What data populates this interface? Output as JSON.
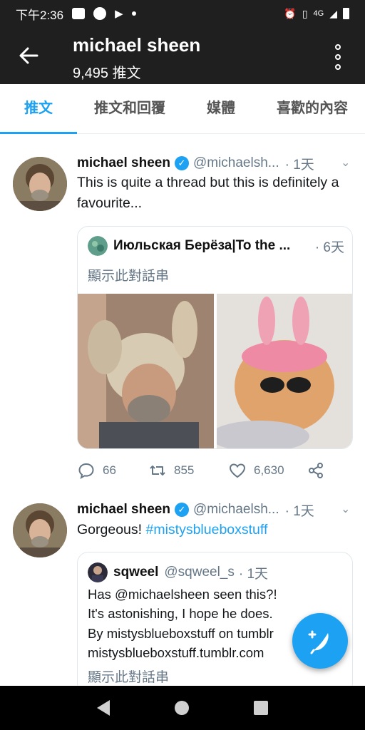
{
  "status_bar": {
    "time": "下午2:36",
    "network": "4G"
  },
  "header": {
    "title": "michael sheen",
    "subtitle": "9,495 推文",
    "back_icon": "arrow-left-icon",
    "menu_icon": "more-vertical-icon"
  },
  "tabs": [
    {
      "label": "推文",
      "active": true
    },
    {
      "label": "推文和回覆",
      "active": false
    },
    {
      "label": "媒體",
      "active": false
    },
    {
      "label": "喜歡的內容",
      "active": false
    }
  ],
  "tweets": [
    {
      "name": "michael sheen",
      "handle": "@michaelsh...",
      "time": "· 1天",
      "text": "This is quite a thread but this is definitely a favourite...",
      "quote": {
        "name": "Июльская Берёза|To the ...",
        "time": "· 6天",
        "link": "顯示此對話串"
      },
      "stats": {
        "replies": "66",
        "retweets": "855",
        "likes": "6,630"
      }
    },
    {
      "name": "michael sheen",
      "handle": "@michaelsh...",
      "time": "· 1天",
      "text_plain": "Gorgeous! ",
      "text_hashtag": "#mistysblueboxstuff",
      "quote": {
        "name": "sqweel",
        "handle": "@sqweel_s",
        "time": "· 1天",
        "lines": [
          "Has @michaelsheen seen this?!",
          "It's astonishing, I hope he does.",
          "By mistysblueboxstuff on tumblr",
          "mistysblueboxstuff.tumblr.com"
        ],
        "link": "顯示此對話串"
      }
    }
  ],
  "colors": {
    "accent": "#1da1f2",
    "appbar": "#1f1f1f",
    "muted": "#657786"
  }
}
